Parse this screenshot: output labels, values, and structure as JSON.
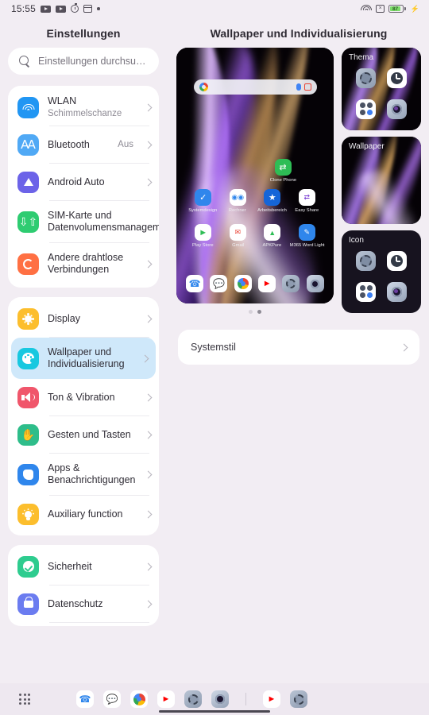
{
  "statusbar": {
    "time": "15:55",
    "left_icons": [
      "video-icon",
      "video-icon",
      "timer-icon",
      "window-icon",
      "dot-icon"
    ],
    "right_icons": [
      "wifi-icon",
      "no-sim-icon",
      "battery-icon"
    ],
    "battery_percent": "87"
  },
  "sidebar": {
    "title": "Einstellungen",
    "search": {
      "placeholder": "Einstellungen durchsu…",
      "icon": "search-icon"
    },
    "groups": [
      {
        "items": [
          {
            "label": "WLAN",
            "sub": "Schimmelschanze",
            "value": "",
            "icon": "wifi-icon",
            "color": "#2196f3"
          },
          {
            "label": "Bluetooth",
            "sub": "",
            "value": "Aus",
            "icon": "bluetooth-icon",
            "color": "#50a9f5"
          },
          {
            "label": "Android Auto",
            "sub": "",
            "value": "",
            "icon": "android-auto-icon",
            "color": "#6c63e8"
          },
          {
            "label": "SIM-Karte und Datenvolumensmanagement",
            "sub": "",
            "value": "",
            "icon": "sim-card-icon",
            "color": "#2ecc71"
          },
          {
            "label": "Andere drahtlose Verbindungen",
            "sub": "",
            "value": "",
            "icon": "wireless-sync-icon",
            "color": "#ff7043"
          }
        ]
      },
      {
        "items": [
          {
            "label": "Display",
            "sub": "",
            "value": "",
            "icon": "brightness-icon",
            "color": "#fcbe2d"
          },
          {
            "label": "Wallpaper und Individualisierung",
            "sub": "",
            "value": "",
            "icon": "palette-icon",
            "color": "#18c8e0",
            "selected": true
          },
          {
            "label": "Ton & Vibration",
            "sub": "",
            "value": "",
            "icon": "speaker-icon",
            "color": "#f0566b"
          },
          {
            "label": "Gesten und Tasten",
            "sub": "",
            "value": "",
            "icon": "hand-icon",
            "color": "#2ebd8a"
          },
          {
            "label": "Apps & Benachrichtigungen",
            "sub": "",
            "value": "",
            "icon": "apps-icon",
            "color": "#2f86ec"
          },
          {
            "label": "Auxiliary function",
            "sub": "",
            "value": "",
            "icon": "bulb-icon",
            "color": "#fcbe2d"
          }
        ]
      },
      {
        "items": [
          {
            "label": "Sicherheit",
            "sub": "",
            "value": "",
            "icon": "shield-check-icon",
            "color": "#2ecc8f"
          },
          {
            "label": "Datenschutz",
            "sub": "",
            "value": "",
            "icon": "lock-icon",
            "color": "#6b7cf0"
          }
        ]
      }
    ]
  },
  "detail": {
    "title": "Wallpaper und Individualisierung",
    "preview": {
      "name": "home-screen-preview",
      "search_widget": {
        "icon": "google-icon",
        "mic_icon": "mic-icon",
        "lens_icon": "lens-icon"
      },
      "app_rows": [
        [
          {
            "name": "Clone Phone",
            "icon": "clone-phone-icon",
            "color": "#2ebd55"
          }
        ],
        [
          {
            "name": "Systemdesign",
            "icon": "system-design-icon",
            "color": "#2f86ec"
          },
          {
            "name": "Rechner",
            "icon": "calculator-icon",
            "color": "#ffffff"
          },
          {
            "name": "Arbeitsbereich",
            "icon": "workspace-icon",
            "color": "#1565d8"
          },
          {
            "name": "Easy Share",
            "icon": "easy-share-icon",
            "color": "#ffffff"
          }
        ],
        [
          {
            "name": "Play Store",
            "icon": "play-store-icon",
            "color": "#ffffff"
          },
          {
            "name": "Gmail",
            "icon": "gmail-icon",
            "color": "#ffffff"
          },
          {
            "name": "APKPure",
            "icon": "apkpure-icon",
            "color": "#ffffff"
          },
          {
            "name": "M365 Word Light",
            "icon": "word-icon",
            "color": "#2f86ec"
          }
        ]
      ],
      "dock": [
        {
          "name": "Telefon",
          "icon": "phone-icon"
        },
        {
          "name": "Nachrichten",
          "icon": "messages-icon"
        },
        {
          "name": "Chrome",
          "icon": "chrome-icon"
        },
        {
          "name": "YouTube",
          "icon": "youtube-icon"
        },
        {
          "name": "Einstellungen",
          "icon": "settings-gear-icon"
        },
        {
          "name": "Kamera",
          "icon": "camera-icon"
        }
      ],
      "page_dots": {
        "count": 2,
        "active": 2
      }
    },
    "cards": [
      {
        "title": "Thema",
        "name": "theme-card"
      },
      {
        "title": "Wallpaper",
        "name": "wallpaper-card"
      },
      {
        "title": "Icon",
        "name": "icon-card"
      }
    ],
    "system_style": {
      "label": "Systemstil"
    }
  },
  "taskbar": {
    "drawer_icon": "app-drawer-icon",
    "apps": [
      {
        "name": "Telefon",
        "icon": "phone-icon"
      },
      {
        "name": "Nachrichten",
        "icon": "messages-icon"
      },
      {
        "name": "Chrome",
        "icon": "chrome-icon"
      },
      {
        "name": "YouTube",
        "icon": "youtube-icon"
      },
      {
        "name": "Einstellungen",
        "icon": "settings-gear-icon"
      },
      {
        "name": "Kamera",
        "icon": "camera-icon"
      }
    ],
    "recent": [
      {
        "name": "YouTube",
        "icon": "youtube-icon"
      },
      {
        "name": "Einstellungen",
        "icon": "settings-gear-icon"
      }
    ]
  },
  "colors": {
    "bg": "#f2edf3",
    "card": "#ffffff",
    "selected": "#cfe8fa",
    "text": "#2f2c35",
    "muted": "#8d8a94"
  }
}
